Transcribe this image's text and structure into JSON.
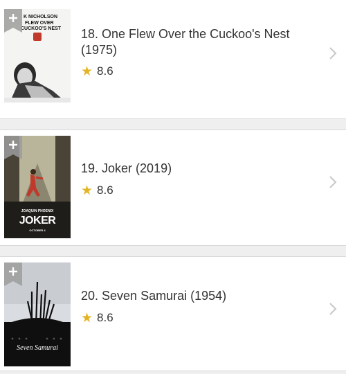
{
  "movies": [
    {
      "rank_title": "18. One Flew Over the Cuckoo's Nest (1975)",
      "rating": "8.6",
      "poster": {
        "top_line": "K NICHOLSON",
        "mid_line_1": "FLEW OVER",
        "mid_line_2": "CUCKOO'S NEST"
      }
    },
    {
      "rank_title": "19. Joker (2019)",
      "rating": "8.6",
      "poster": {
        "actor": "JOAQUIN PHOENIX",
        "title": "JOKER",
        "date": "OCTOBER 4"
      }
    },
    {
      "rank_title": "20. Seven Samurai (1954)",
      "rating": "8.6",
      "poster": {
        "title": "Seven Samurai"
      }
    }
  ],
  "icons": {
    "add": "plus-bookmark-icon",
    "star": "star-icon",
    "chevron": "chevron-right-icon"
  },
  "colors": {
    "star": "#e3b424",
    "separator": "#efefef",
    "text": "#333333",
    "badge": "#9c9c9c"
  }
}
